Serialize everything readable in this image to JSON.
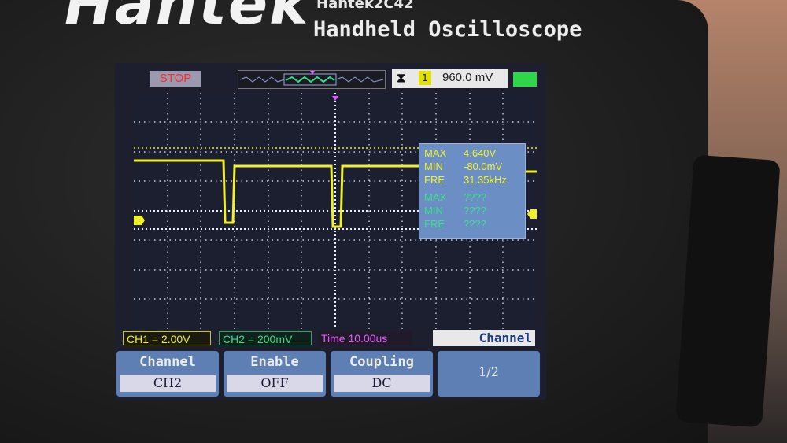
{
  "device": {
    "brand": "Hantek",
    "model": "Hantek2C42",
    "subtitle": "Handheld Oscilloscope"
  },
  "top_bar": {
    "run_state": "STOP",
    "trigger_source": "1",
    "trigger_level": "960.0 mV"
  },
  "measurements": {
    "ch1": [
      {
        "label": "MAX",
        "value": "4.640V"
      },
      {
        "label": "MIN",
        "value": "-80.0mV"
      },
      {
        "label": "FRE",
        "value": "31.35kHz"
      }
    ],
    "ch2": [
      {
        "label": "MAX",
        "value": "????"
      },
      {
        "label": "MIN",
        "value": "????"
      },
      {
        "label": "FRE",
        "value": "????"
      }
    ]
  },
  "status_bar": {
    "ch1_scale": "CH1 = 2.00V",
    "ch2_scale": "CH2 = 200mV",
    "time_scale": "Time  10.00us",
    "menu_title": "Channel"
  },
  "softkeys": [
    {
      "label": "Channel",
      "value": "CH2"
    },
    {
      "label": "Enable",
      "value": "OFF"
    },
    {
      "label": "Coupling",
      "value": "DC"
    },
    {
      "label": "",
      "value": "1/2"
    }
  ],
  "colors": {
    "ch1": "#f0f02a",
    "ch2": "#2fe08a",
    "timebase": "#e858ff",
    "softkey_bg": "#5d7fb4"
  }
}
